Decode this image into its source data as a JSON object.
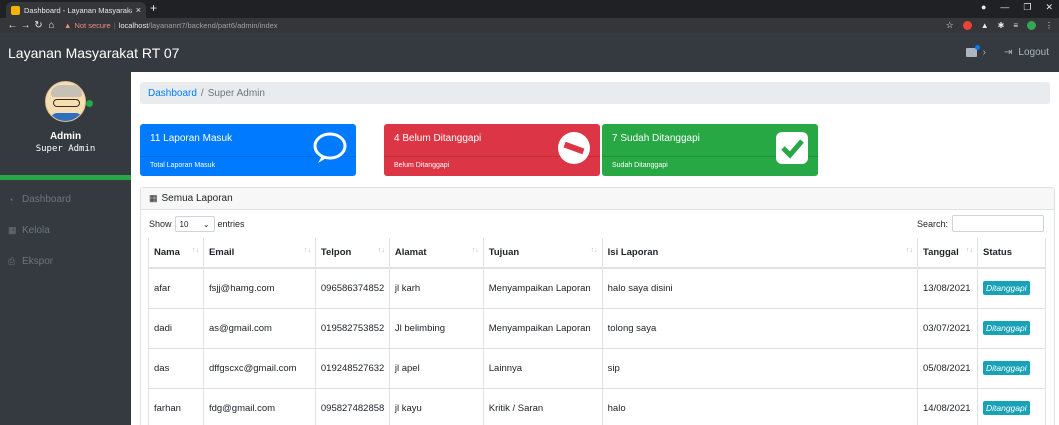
{
  "browser": {
    "tab_title": "Dashboard - Layanan Masyarakat",
    "new_tab": "+",
    "not_secure": "Not secure",
    "host": "localhost",
    "path": "/layananrt7/backend/part6/admin/index"
  },
  "navbar": {
    "brand": "Layanan Masyarakat RT 07",
    "logout": "Logout"
  },
  "sidebar": {
    "name": "Admin",
    "role": "Super Admin",
    "items": [
      {
        "label": "Dashboard",
        "icon": "tachometer-icon"
      },
      {
        "label": "Kelola",
        "icon": "table-icon"
      },
      {
        "label": "Ekspor",
        "icon": "print-icon"
      }
    ]
  },
  "breadcrumb": {
    "link": "Dashboard",
    "separator": "/",
    "active": "Super Admin"
  },
  "stats": [
    {
      "title": "11 Laporan Masuk",
      "footer": "Total Laporan Masuk",
      "color": "#007bff",
      "icon": "comment-icon"
    },
    {
      "title": "4 Belum Ditanggapi",
      "footer": "Belum Ditanggapi",
      "color": "#dc3545",
      "icon": "minus-circle-icon"
    },
    {
      "title": "7 Sudah Ditanggapi",
      "footer": "Sudah Ditanggapi",
      "color": "#28a745",
      "icon": "check-square-icon"
    }
  ],
  "table_card": {
    "title": "Semua Laporan",
    "show": "Show",
    "entries_value": "10",
    "entries": "entries",
    "search": "Search:",
    "columns": [
      "Nama",
      "Email",
      "Telpon",
      "Alamat",
      "Tujuan",
      "Isi Laporan",
      "Tanggal",
      "Status"
    ],
    "rows": [
      [
        "afar",
        "fsjj@hamg.com",
        "096586374852",
        "jl karh",
        "Menyampaikan Laporan",
        "halo saya disini",
        "13/08/2021",
        "Ditanggapi"
      ],
      [
        "dadi",
        "as@gmail.com",
        "019582753852",
        "Jl belimbing",
        "Menyampaikan Laporan",
        "tolong saya",
        "03/07/2021",
        "Ditanggapi"
      ],
      [
        "das",
        "dffgscxc@gmail.com",
        "019248527632",
        "jl apel",
        "Lainnya",
        "sip",
        "05/08/2021",
        "Ditanggapi"
      ],
      [
        "farhan",
        "fdg@gmail.com",
        "095827482858",
        "jl kayu",
        "Kritik / Saran",
        "halo",
        "14/08/2021",
        "Ditanggapi"
      ]
    ]
  }
}
